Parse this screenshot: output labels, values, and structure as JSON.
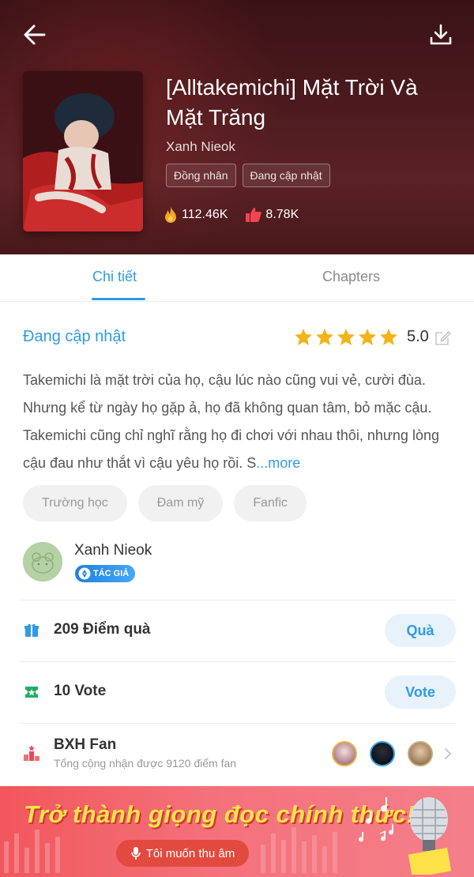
{
  "header": {
    "title": "[Alltakemichi] Mặt Trời Và Mặt Trăng",
    "author": "Xanh Nieok",
    "tags": [
      "Đồng nhân",
      "Đang cập nhật"
    ],
    "views": "112.46K",
    "likes": "8.78K"
  },
  "tabs": {
    "details": "Chi tiết",
    "chapters": "Chapters"
  },
  "details": {
    "status": "Đang cập nhật",
    "rating": "5.0",
    "rating_stars": 5,
    "description": "Takemichi là mặt trời của họ, cậu lúc nào cũng vui vẻ, cười đùa. Nhưng kể từ ngày họ gặp ả, họ đã không quan tâm, bỏ mặc cậu. Takemichi cũng chỉ nghĩ rằng họ đi chơi với nhau thôi, nhưng lòng cậu đau như thắt vì cậu yêu họ rồi. S",
    "more": "...more",
    "genres": [
      "Trường học",
      "Đam mỹ",
      "Fanfic"
    ]
  },
  "author_card": {
    "name": "Xanh Nieok",
    "badge": "TÁC GIẢ"
  },
  "gifts": {
    "label": "209 Điểm quà",
    "button": "Quà"
  },
  "votes": {
    "label": "10 Vote",
    "button": "Vote"
  },
  "fan_ranking": {
    "title": "BXH Fan",
    "subtitle": "Tổng cộng nhận được 9120 điểm fan"
  },
  "banner": {
    "title": "Trở thành giọng đọc chính thức!",
    "button": "Tôi muốn thu âm"
  },
  "colors": {
    "accent": "#2f9be6",
    "star": "#f5b31b",
    "banner_text": "#ffe24a"
  }
}
